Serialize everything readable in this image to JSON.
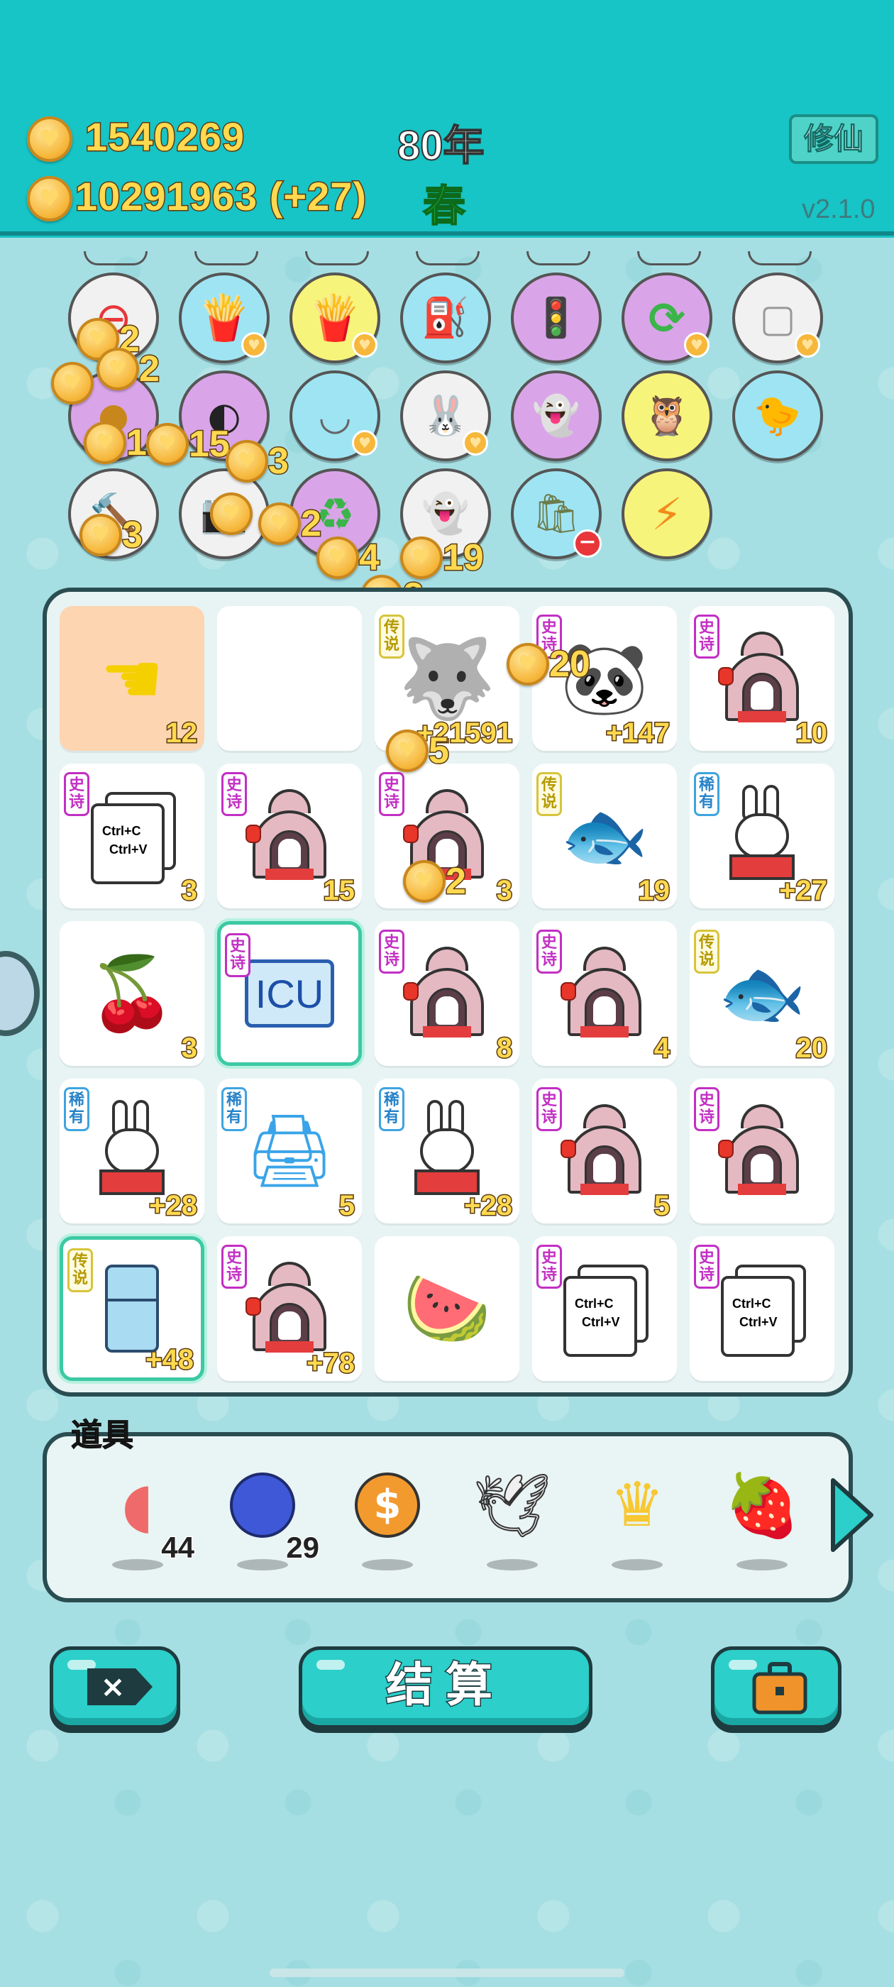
{
  "header": {
    "coins_primary": "1540269",
    "coins_secondary": "10291963 (+27)",
    "year": "80年",
    "season": "春",
    "xiuxian_label": "修仙",
    "version": "v2.1.0"
  },
  "buffs": {
    "row1": [
      "no-entry-icon",
      "fries-icon",
      "fries-icon",
      "pump-icon",
      "traffic-ghost-icon",
      "refresh-icon",
      "dice-icon"
    ],
    "row2": [
      "coin-pile-icon",
      "eyepatch-icon",
      "rice-bowl-icon",
      "bunny-icon",
      "ghost-icon",
      "owl-icon",
      "chick-egg-icon"
    ],
    "row3": [
      "hammer-icon",
      "camera-icon",
      "recycle-icon",
      "ghost-wink-icon",
      "trash-bag-icon",
      "lightning-icon"
    ]
  },
  "floating_coins": [
    "2",
    "2",
    "12",
    "15",
    "3",
    "3",
    "2",
    "4",
    "19",
    "2",
    "20",
    "5",
    "2"
  ],
  "board": {
    "rows": [
      [
        {
          "icon": "pointing-hand-icon",
          "badge": "",
          "value": "12"
        },
        {
          "icon": "empty",
          "badge": "",
          "value": ""
        },
        {
          "icon": "husky-king-icon",
          "badge": "传说",
          "value": "+21591"
        },
        {
          "icon": "panda-icon",
          "badge": "史诗",
          "value": "+147"
        },
        {
          "icon": "bunny-tent-icon",
          "badge": "史诗",
          "value": "10"
        }
      ],
      [
        {
          "icon": "copy-paste-icon",
          "badge": "史诗",
          "value": "3"
        },
        {
          "icon": "bunny-tent-icon",
          "badge": "史诗",
          "value": "15"
        },
        {
          "icon": "bunny-tent-icon",
          "badge": "史诗",
          "value": "3"
        },
        {
          "icon": "koi-icon",
          "badge": "传说",
          "value": "19"
        },
        {
          "icon": "bunny-icon",
          "badge": "稀有",
          "value": "+27"
        }
      ],
      [
        {
          "icon": "cherry-icon",
          "badge": "",
          "value": "3"
        },
        {
          "icon": "icu-icon",
          "badge": "史诗",
          "value": ""
        },
        {
          "icon": "bunny-tent-icon",
          "badge": "史诗",
          "value": "8"
        },
        {
          "icon": "bunny-tent-icon",
          "badge": "史诗",
          "value": "4"
        },
        {
          "icon": "koi-icon",
          "badge": "传说",
          "value": "20"
        }
      ],
      [
        {
          "icon": "bunny-icon",
          "badge": "稀有",
          "value": "+28"
        },
        {
          "icon": "printer-icon",
          "badge": "稀有",
          "value": "5"
        },
        {
          "icon": "bunny-icon",
          "badge": "稀有",
          "value": "+28"
        },
        {
          "icon": "bunny-tent-icon",
          "badge": "史诗",
          "value": "5"
        },
        {
          "icon": "bunny-tent-icon",
          "badge": "史诗",
          "value": ""
        }
      ],
      [
        {
          "icon": "fridge-icon",
          "badge": "传说",
          "value": "+48"
        },
        {
          "icon": "bunny-tent-icon",
          "badge": "史诗",
          "value": "+78"
        },
        {
          "icon": "watermelon-icon",
          "badge": "",
          "value": ""
        },
        {
          "icon": "copy-paste-icon",
          "badge": "史诗",
          "value": ""
        },
        {
          "icon": "copy-paste-icon",
          "badge": "史诗",
          "value": ""
        }
      ]
    ],
    "copy_text_1": "Ctrl+C",
    "copy_text_2": "Ctrl+V",
    "icu_text": "ICU"
  },
  "items": {
    "title": "道具",
    "list": [
      {
        "icon": "liver-icon",
        "count": "44"
      },
      {
        "icon": "blueberry-icon",
        "count": "29"
      },
      {
        "icon": "dollar-coin-icon",
        "count": ""
      },
      {
        "icon": "dove-icon",
        "count": ""
      },
      {
        "icon": "crown-icon",
        "count": ""
      },
      {
        "icon": "strawberry-icon",
        "count": ""
      }
    ]
  },
  "buttons": {
    "settle_label": "结算"
  },
  "colors": {
    "header_bg": "#17c4c6",
    "epic_badge": "#c22fc4",
    "legend_badge": "#d7c43c",
    "rare_badge": "#3ea4e0",
    "coin_text": "#ffd94f"
  }
}
